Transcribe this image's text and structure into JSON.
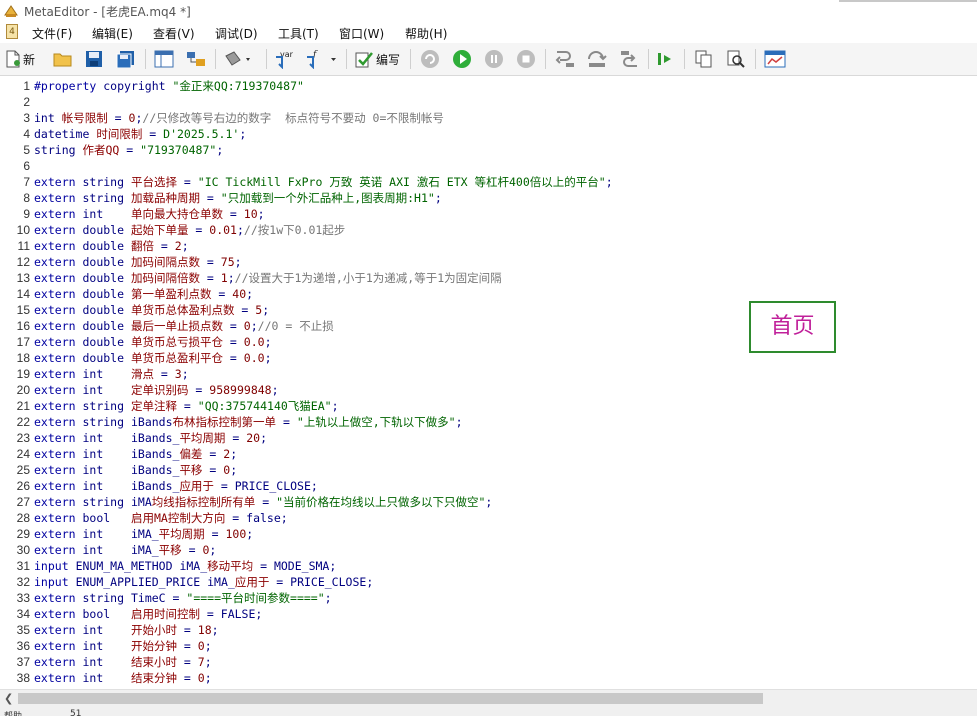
{
  "window": {
    "title": "MetaEditor - [老虎EA.mq4 *]"
  },
  "menubar": {
    "items": [
      "文件(F)",
      "编辑(E)",
      "查看(V)",
      "调试(D)",
      "工具(T)",
      "窗口(W)",
      "帮助(H)"
    ]
  },
  "toolbar": {
    "new_label": "新",
    "compile_label": "编写",
    "icons": [
      "new-file-icon",
      "open-folder-icon",
      "save-icon",
      "save-all-icon",
      "navigator-icon",
      "toolbox-icon",
      "styler-icon",
      "insert-var-icon",
      "insert-function-icon",
      "compile-icon",
      "stop-compile-icon",
      "start-debug-icon",
      "pause-icon",
      "stop-icon",
      "step-into-icon",
      "step-over-icon",
      "step-out-icon",
      "go-to-icon",
      "copy-icon",
      "find-icon",
      "terminal-icon"
    ]
  },
  "editor": {
    "lines": [
      {
        "n": "1",
        "t": "#property copyright \"金正来QQ:719370487\""
      },
      {
        "n": "2",
        "t": ""
      },
      {
        "n": "3",
        "t": "int 帐号限制 = 0;//只修改等号右边的数字  标点符号不要动 0=不限制帐号"
      },
      {
        "n": "4",
        "t": "datetime 时间限制 = D'2025.5.1';"
      },
      {
        "n": "5",
        "t": "string 作者QQ = \"719370487\";"
      },
      {
        "n": "6",
        "t": ""
      },
      {
        "n": "7",
        "t": "extern string 平台选择 = \"IC TickMill FxPro 万致 英诺 AXI 激石 ETX 等杠杆400倍以上的平台\";"
      },
      {
        "n": "8",
        "t": "extern string 加载品种周期 = \"只加载到一个外汇品种上,图表周期:H1\";"
      },
      {
        "n": "9",
        "t": "extern int    单向最大持仓单数 = 10;"
      },
      {
        "n": "10",
        "t": "extern double 起始下单量 = 0.01;//按1w下0.01起步"
      },
      {
        "n": "11",
        "t": "extern double 翻倍 = 2;"
      },
      {
        "n": "12",
        "t": "extern double 加码间隔点数 = 75;"
      },
      {
        "n": "13",
        "t": "extern double 加码间隔倍数 = 1;//设置大于1为递增,小于1为递减,等于1为固定间隔"
      },
      {
        "n": "14",
        "t": "extern double 第一单盈利点数 = 40;"
      },
      {
        "n": "15",
        "t": "extern double 单货币总体盈利点数 = 5;"
      },
      {
        "n": "16",
        "t": "extern double 最后一单止损点数 = 0;//0 = 不止损"
      },
      {
        "n": "17",
        "t": "extern double 单货币总亏损平仓 = 0.0;"
      },
      {
        "n": "18",
        "t": "extern double 单货币总盈利平仓 = 0.0;"
      },
      {
        "n": "19",
        "t": "extern int    滑点 = 3;"
      },
      {
        "n": "20",
        "t": "extern int    定单识别码 = 958999848;"
      },
      {
        "n": "21",
        "t": "extern string 定单注释 = \"QQ:375744140飞猫EA\";"
      },
      {
        "n": "22",
        "t": "extern string iBands布林指标控制第一单 = \"上轨以上做空,下轨以下做多\";"
      },
      {
        "n": "23",
        "t": "extern int    iBands_平均周期 = 20;"
      },
      {
        "n": "24",
        "t": "extern int    iBands_偏差 = 2;"
      },
      {
        "n": "25",
        "t": "extern int    iBands_平移 = 0;"
      },
      {
        "n": "26",
        "t": "extern int    iBands_应用于 = PRICE_CLOSE;"
      },
      {
        "n": "27",
        "t": "extern string iMA均线指标控制所有单 = \"当前价格在均线以上只做多以下只做空\";"
      },
      {
        "n": "28",
        "t": "extern bool   启用MA控制大方向 = false;"
      },
      {
        "n": "29",
        "t": "extern int    iMA_平均周期 = 100;"
      },
      {
        "n": "30",
        "t": "extern int    iMA_平移 = 0;"
      },
      {
        "n": "31",
        "t": "input ENUM_MA_METHOD iMA_移动平均 = MODE_SMA;"
      },
      {
        "n": "32",
        "t": "input ENUM_APPLIED_PRICE iMA_应用于 = PRICE_CLOSE;"
      },
      {
        "n": "33",
        "t": "extern string TimeC = \"====平台时间参数====\";"
      },
      {
        "n": "34",
        "t": "extern bool   启用时间控制 = FALSE;"
      },
      {
        "n": "35",
        "t": "extern int    开始小时 = 18;"
      },
      {
        "n": "36",
        "t": "extern int    开始分钟 = 0;"
      },
      {
        "n": "37",
        "t": "extern int    结束小时 = 7;"
      },
      {
        "n": "38",
        "t": "extern int    结束分钟 = 0;"
      }
    ]
  },
  "overlay": {
    "home_label": "首页"
  },
  "status": {
    "help_label": "帮助",
    "pos_label": "51"
  }
}
